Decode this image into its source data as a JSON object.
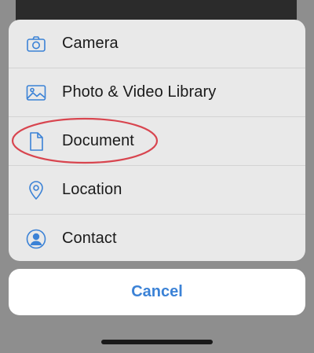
{
  "action_sheet": {
    "items": [
      {
        "label": "Camera",
        "icon": "camera-icon"
      },
      {
        "label": "Photo & Video Library",
        "icon": "photo-library-icon"
      },
      {
        "label": "Document",
        "icon": "document-icon"
      },
      {
        "label": "Location",
        "icon": "location-pin-icon"
      },
      {
        "label": "Contact",
        "icon": "contact-icon"
      }
    ]
  },
  "cancel": {
    "label": "Cancel"
  },
  "colors": {
    "icon_blue": "#3b82d6",
    "annotation_red": "#d8454f",
    "sheet_bg": "#e9e9e9",
    "cancel_bg": "#ffffff"
  }
}
